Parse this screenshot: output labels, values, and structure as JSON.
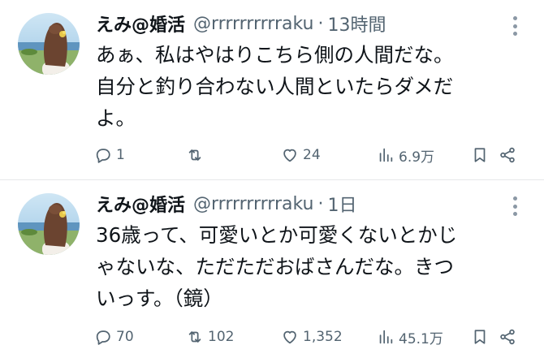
{
  "tweets": [
    {
      "author": {
        "display_name": "えみ@婚活",
        "handle": "@rrrrrrrrrraku"
      },
      "separator": "·",
      "time": "13時間",
      "text_lines": [
        "あぁ、私はやはりこちら側の人間だな。",
        "自分と釣り合わない人間といたらダメだ",
        "よ。"
      ],
      "stats": {
        "replies": "1",
        "retweets": "",
        "likes": "24",
        "views": "6.9万"
      }
    },
    {
      "author": {
        "display_name": "えみ@婚活",
        "handle": "@rrrrrrrrrraku"
      },
      "separator": "·",
      "time": "1日",
      "text_lines": [
        "36歳って、可愛いとか可愛くないとかじ",
        "ゃないな、ただただおばさんだな。きつ",
        "いっす。（鏡）"
      ],
      "stats": {
        "replies": "70",
        "retweets": "102",
        "likes": "1,352",
        "views": "45.1万"
      }
    }
  ],
  "icons": [
    "reply-icon",
    "retweet-icon",
    "like-icon",
    "views-icon",
    "bookmark-icon",
    "share-icon",
    "more-icon"
  ],
  "colors": {
    "text": "#0f1419",
    "secondary": "#536471",
    "divider": "#e6e8ea"
  }
}
